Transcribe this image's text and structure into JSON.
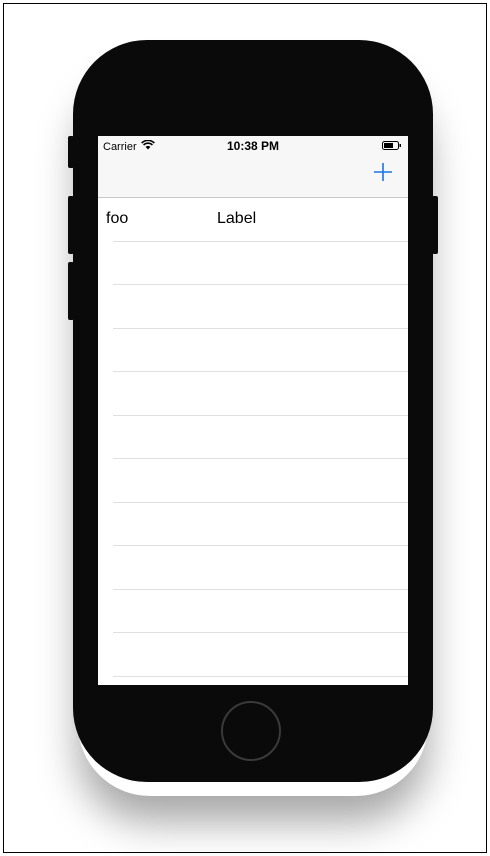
{
  "status_bar": {
    "carrier": "Carrier",
    "time": "10:38 PM",
    "wifi_icon": "wifi-icon",
    "battery_icon": "battery-icon"
  },
  "nav_bar": {
    "add_icon": "plus-icon",
    "accent_color": "#1a73e8"
  },
  "table": {
    "rows": [
      {
        "title": "foo",
        "detail": "Label"
      },
      {
        "title": "",
        "detail": ""
      },
      {
        "title": "",
        "detail": ""
      },
      {
        "title": "",
        "detail": ""
      },
      {
        "title": "",
        "detail": ""
      },
      {
        "title": "",
        "detail": ""
      },
      {
        "title": "",
        "detail": ""
      },
      {
        "title": "",
        "detail": ""
      },
      {
        "title": "",
        "detail": ""
      },
      {
        "title": "",
        "detail": ""
      },
      {
        "title": "",
        "detail": ""
      }
    ]
  },
  "device": {
    "body_color": "#0a0a0a",
    "home_button_icon": "home-button-icon"
  }
}
